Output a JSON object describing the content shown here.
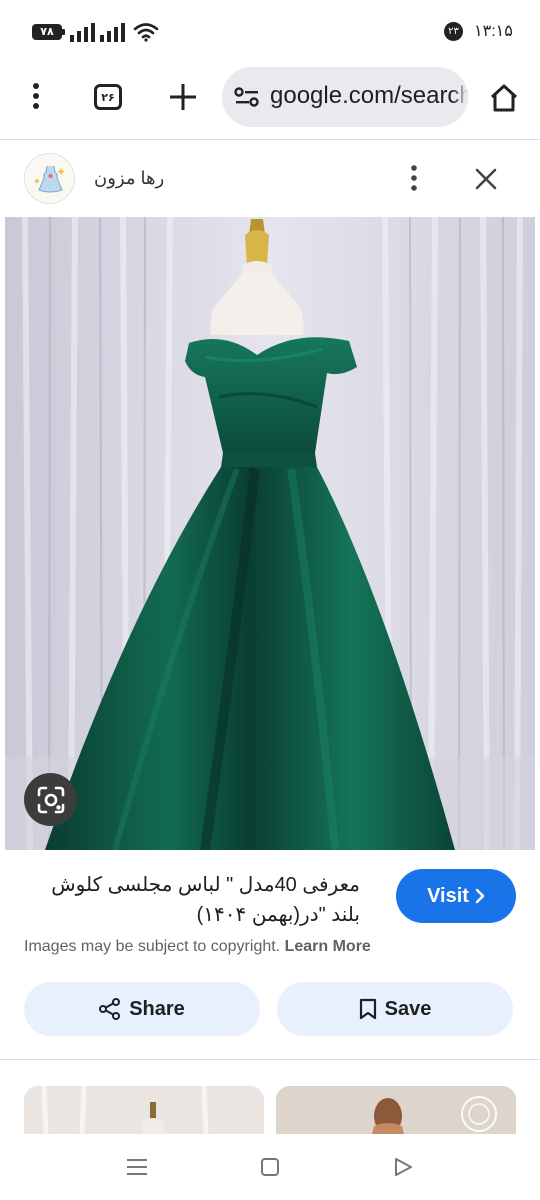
{
  "status_bar": {
    "battery": "۷۸",
    "notification_count": "۲۳",
    "time": "۱۳:۱۵"
  },
  "browser": {
    "tab_count": "۲۶",
    "url": "google.com/search"
  },
  "result": {
    "source_name": "رها مزون",
    "title": "معرفی 40مدل \" لباس مجلسی کلوش بلند \"در(بهمن ۱۴۰۴)",
    "visit_label": "Visit",
    "copyright_notice": "Images may be subject to copyright.",
    "learn_more": "Learn More",
    "share_label": "Share",
    "save_label": "Save"
  },
  "colors": {
    "accent": "#1a73e8",
    "action_bg": "#e8f0fe",
    "dress_green": "#0e5a44"
  }
}
